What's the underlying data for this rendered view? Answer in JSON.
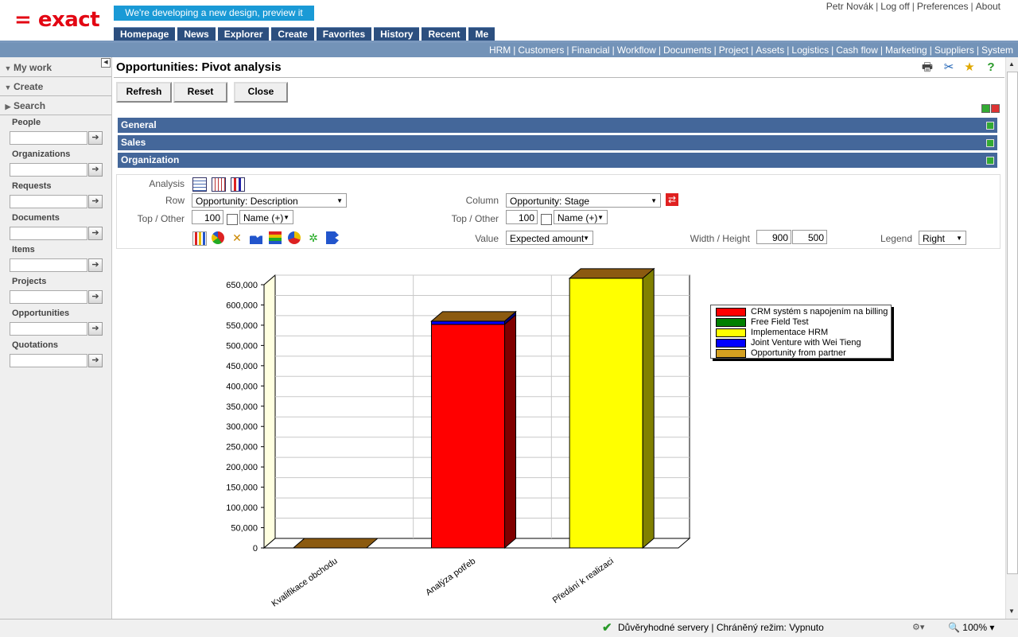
{
  "header": {
    "logo": "= exact",
    "preview_banner": "We're developing a new design, preview it here!",
    "top_links": [
      "Petr Novák",
      "Log off",
      "Preferences",
      "About"
    ],
    "nav_tabs": [
      "Homepage",
      "News",
      "Explorer",
      "Create",
      "Favorites",
      "History",
      "Recent",
      "Me"
    ],
    "modules": [
      "HRM",
      "Customers",
      "Financial",
      "Workflow",
      "Documents",
      "Project",
      "Assets",
      "Logistics",
      "Cash flow",
      "Marketing",
      "Suppliers",
      "System"
    ]
  },
  "sidebar": {
    "sections": [
      "My work",
      "Create",
      "Search"
    ],
    "searches": [
      "People",
      "Organizations",
      "Requests",
      "Documents",
      "Items",
      "Projects",
      "Opportunities",
      "Quotations"
    ]
  },
  "page": {
    "title": "Opportunities: Pivot analysis",
    "buttons": {
      "refresh": "Refresh",
      "reset": "Reset",
      "close": "Close"
    },
    "sections": [
      "General",
      "Sales",
      "Organization"
    ]
  },
  "settings": {
    "analysis_label": "Analysis",
    "row_label": "Row",
    "row_value": "Opportunity: Description",
    "column_label": "Column",
    "column_value": "Opportunity: Stage",
    "topother_label": "Top / Other",
    "row_top": "100",
    "row_sort": "Name (+)",
    "col_top": "100",
    "col_sort": "Name (+)",
    "value_label": "Value",
    "value_value": "Expected amount",
    "wh_label": "Width / Height",
    "width": "900",
    "height": "500",
    "legend_label": "Legend",
    "legend_value": "Right"
  },
  "chart_data": {
    "type": "bar",
    "stacked": true,
    "categories": [
      "Kvalifikace obchodu",
      "Analýza potřeb",
      "Předání k realizaci"
    ],
    "series": [
      {
        "name": "CRM systém s napojením na billing",
        "color": "#ff0000",
        "values": [
          0,
          552000,
          0
        ]
      },
      {
        "name": "Free Field Test",
        "color": "#008000",
        "values": [
          0,
          0,
          0
        ]
      },
      {
        "name": "Implementace HRM",
        "color": "#ffff00",
        "values": [
          0,
          0,
          666000
        ]
      },
      {
        "name": "Joint Venture with Wei Tieng",
        "color": "#0000ff",
        "values": [
          0,
          8000,
          0
        ]
      },
      {
        "name": "Opportunity from partner",
        "color": "#d4a020",
        "values": [
          0,
          0,
          0
        ]
      }
    ],
    "yticks": [
      "0",
      "50,000",
      "100,000",
      "150,000",
      "200,000",
      "250,000",
      "300,000",
      "350,000",
      "400,000",
      "450,000",
      "500,000",
      "550,000",
      "600,000",
      "650,000"
    ],
    "ylim": [
      0,
      650000
    ],
    "grid": true,
    "legend_position": "right"
  },
  "statusbar": {
    "security": "Důvěryhodné servery | Chráněný režim: Vypnuto",
    "zoom": "100%"
  }
}
